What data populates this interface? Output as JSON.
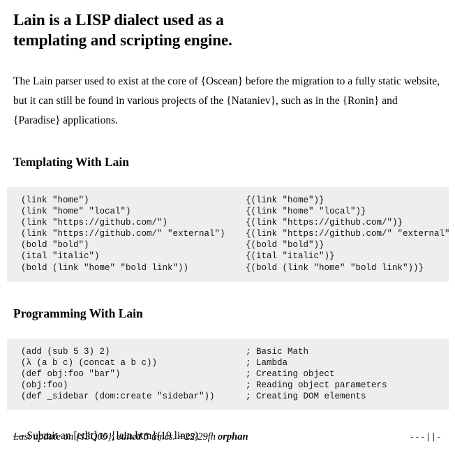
{
  "document": {
    "title": "Lain is a LISP dialect used as a templating and scripting engine.",
    "intro": "The Lain parser used to exist at the core of {Oscean} before the migration to a fully static website, but it can still be found in various projects of the {Nataniev}, such as in the {Ronin} and {Paradise} applications."
  },
  "sections": [
    {
      "heading": "Templating With Lain",
      "code": {
        "left": [
          "(link \"home\")",
          "(link \"home\" \"local\")",
          "(link \"https://github.com/\")",
          "(link \"https://github.com/\" \"external\")",
          "(bold \"bold\")",
          "(ital \"italic\")",
          "(bold (link \"home\" \"bold link\"))"
        ],
        "right": [
          "{(link \"home\")}",
          "{(link \"home\" \"local\")}",
          "{(link \"https://github.com/\")}",
          "{(link \"https://github.com/\" \"external\")}",
          "{(bold \"bold\")}",
          "{(ital \"italic\")}",
          "{(bold (link \"home\" \"bold link\"))}"
        ]
      }
    },
    {
      "heading": "Programming With Lain",
      "code": {
        "left": [
          "(add (sub 5 3) 2)",
          "(λ (a b c) (concat a b c))",
          "(def obj:foo \"bar\")",
          "(obj:foo)",
          "(def _sidebar (dom:create \"sidebar\"))"
        ],
        "right": [
          "; Basic Math",
          "; Lambda",
          "; Creating object",
          "; Reading object parameters",
          "; Creating DOM elements"
        ]
      }
    }
  ],
  "submit": {
    "text": "— Submit an [edit] to {lain.htm}(19 lines)"
  },
  "footer": {
    "last_update": "Last update on {13Q05}, edited 5 times. +22/29fh",
    "author": "orphan",
    "glyphs": "---||-"
  },
  "colors": {
    "page_background": "#ffffff",
    "text": "#000000",
    "code_background": "#eeeeee"
  }
}
